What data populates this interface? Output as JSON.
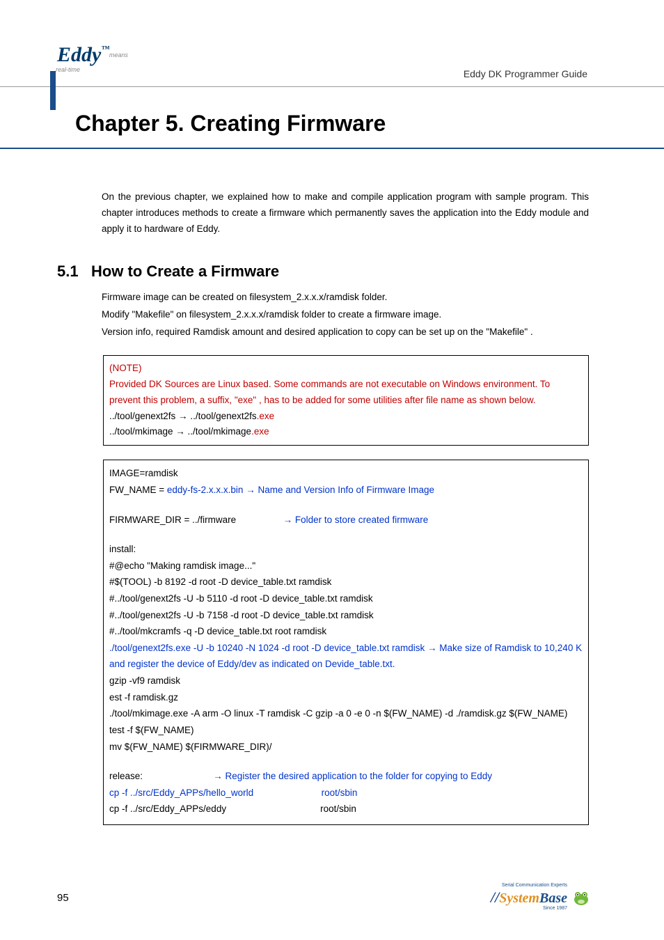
{
  "header": {
    "logo_main": "Eddy",
    "logo_tm": "™",
    "logo_sub1": "means",
    "logo_sub2": "real-time",
    "right_text": "Eddy DK Programmer Guide"
  },
  "chapter": {
    "title": "Chapter 5.    Creating  Firmware"
  },
  "intro": "On the previous chapter, we explained how to make and compile application program with sample program.  This chapter introduces methods to create a firmware which permanently saves the application into the Eddy module and apply it to hardware of Eddy.",
  "section": {
    "number": "5.1",
    "title": "How  to  Create  a  Firmware",
    "body1": "Firmware image can be created on filesystem_2.x.x.x/ramdisk folder.",
    "body2": "Modify   \"Makefile\"   on filesystem_2.x.x.x/ramdisk folder to create a firmware image.",
    "body3": "Version info, required Ramdisk amount and desired application to copy can be set up on the   \"Makefile\"  ."
  },
  "note": {
    "label": "(NOTE)",
    "line1": "Provided DK Sources are Linux based.  Some commands are not executable on Windows environment.  To prevent this problem, a suffix,   \"exe\"  , has to be added for some utilities after file name as shown below.",
    "line2a": "../tool/genext2fs   →  ../tool/genext2fs",
    "line2b": ".exe",
    "line3a": "../tool/mkimage   →  ../tool/mkimage",
    "line3b": ".exe"
  },
  "code": {
    "l1": "IMAGE=ramdisk",
    "l2a": "FW_NAME        =     ",
    "l2b": "eddy-fs-2.x.x.x.bin",
    "l2c": "         → Name and Version Info of Firmware Image",
    "l3": " ",
    "l4a": "FIRMWARE_DIR =    ../firmware",
    "l4b": "                  → Folder to store created firmware",
    "l5": " ",
    "l6": "install:",
    "l7": "#@echo \"Making ramdisk image...\"",
    "l8": "#$(TOOL) -b 8192 -d root -D device_table.txt ramdisk",
    "l9": "#../tool/genext2fs   -U -b 5110 -d root -D device_table.txt ramdisk",
    "l10": "#../tool/genext2fs   -U -b 7158 -d root -D device_table.txt ramdisk",
    "l11": "#../tool/mkcramfs    -q -D device_table.txt root ramdisk",
    "l12a": "./tool/genext2fs.exe   -U -b 10240 -N 1024 -d root -D device_table.txt ramdisk   ",
    "l12b": "→",
    "l12c": " Make size of Ramdisk to 10,240 K and register the device of Eddy/dev as indicated on Devide_table.txt.",
    "l13": "gzip -vf9 ramdisk",
    "l14": "est -f ramdisk.gz",
    "l15": "./tool/mkimage.exe -A arm -O linux -T ramdisk -C gzip -a 0 -e 0 -n $(FW_NAME) -d ./ramdisk.gz $(FW_NAME)",
    "l16": "test -f $(FW_NAME)",
    "l17": "mv $(FW_NAME) $(FIRMWARE_DIR)/",
    "l18": " ",
    "l19a": "release:",
    "l19b": "                           → Register the desired application to the folder for copying to Eddy",
    "l20a": "cp -f ../src/Eddy_APPs/hello_world                          root/sbin",
    "l21a": "cp -f ../src/Eddy_APPs/eddy",
    "l21b": "                                    root/sbin"
  },
  "footer": {
    "page": "95",
    "logo_sys": "System",
    "logo_base": "Base",
    "logo_tag1": "Serial Communication Experts",
    "logo_tag2": "Since 1987"
  }
}
